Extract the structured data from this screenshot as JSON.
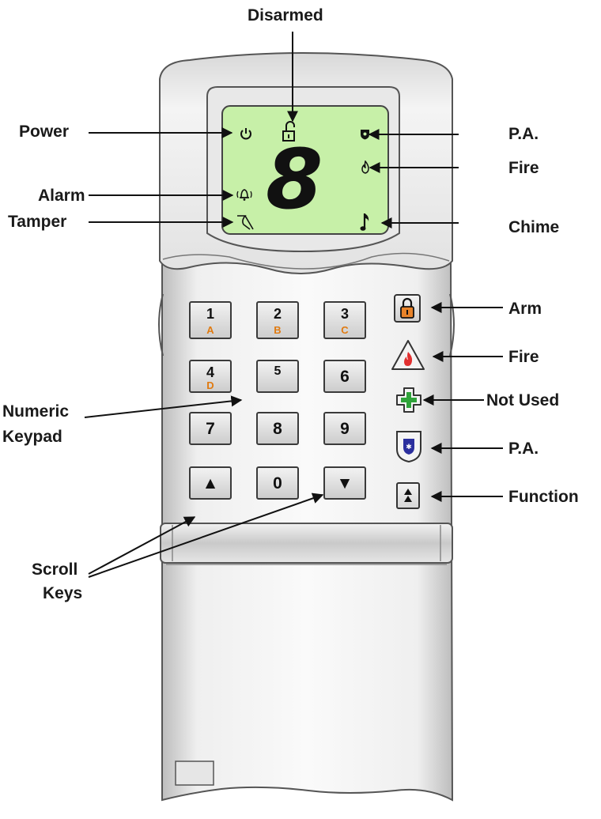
{
  "callouts": {
    "disarmed": "Disarmed",
    "power": "Power",
    "pa_top": "P.A.",
    "fire_top": "Fire",
    "alarm": "Alarm",
    "tamper": "Tamper",
    "chime": "Chime",
    "arm": "Arm",
    "fire": "Fire",
    "not_used": "Not Used",
    "pa": "P.A.",
    "function": "Function",
    "numeric": "Numeric",
    "keypad": "Keypad",
    "scroll": "Scroll",
    "keys": "Keys"
  },
  "lcd": {
    "digit": "8"
  },
  "keys": [
    {
      "num": "1",
      "letter": "A"
    },
    {
      "num": "2",
      "letter": "B"
    },
    {
      "num": "3",
      "letter": "C"
    },
    {
      "num": "4",
      "letter": "D"
    },
    {
      "num": "5",
      "letter": ""
    },
    {
      "num": "6",
      "letter": ""
    },
    {
      "num": "7",
      "letter": ""
    },
    {
      "num": "8",
      "letter": ""
    },
    {
      "num": "9",
      "letter": ""
    },
    {
      "num": "▲",
      "letter": ""
    },
    {
      "num": "0",
      "letter": ""
    },
    {
      "num": "▼",
      "letter": ""
    }
  ],
  "colors": {
    "lcd": "#c7f0a8",
    "letters": "#e07a10",
    "arm": "#e8832a",
    "fire": "#e23030",
    "cross": "#2fa33a",
    "pa": "#2b2f9e"
  },
  "icons": {
    "power": "power-icon",
    "unlock": "unlock-icon",
    "pa": "police-badge-icon",
    "fire": "flame-icon",
    "alarm": "bell-icon",
    "tamper": "tamper-icon",
    "chime": "music-note-icon",
    "arm": "padlock-icon",
    "fire_key": "fire-triangle-icon",
    "not_used": "cross-icon",
    "pa_key": "shield-icon",
    "function": "double-chevron-icon"
  }
}
